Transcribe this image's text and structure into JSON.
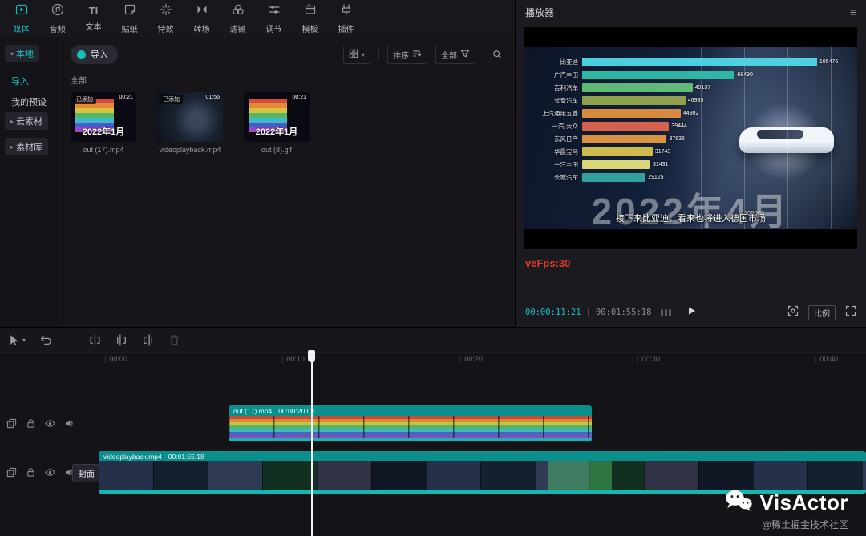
{
  "topbar": {
    "items": [
      {
        "label": "媒体"
      },
      {
        "label": "音频"
      },
      {
        "label": "文本"
      },
      {
        "label": "贴纸"
      },
      {
        "label": "特效"
      },
      {
        "label": "转场"
      },
      {
        "label": "滤镜"
      },
      {
        "label": "调节"
      },
      {
        "label": "模板"
      },
      {
        "label": "插件"
      }
    ]
  },
  "sidebar": {
    "local": "本地",
    "import": "导入",
    "presets": "我的预设",
    "cloud": "云素材",
    "library": "素材库"
  },
  "media": {
    "import_button": "导入",
    "sort": "排序",
    "filter": "全部",
    "group": "全部",
    "items": [
      {
        "name": "out (17).mp4",
        "duration": "00:21",
        "badge": "已添加",
        "overlay": "2022年1月"
      },
      {
        "name": "videoplayback.mp4",
        "duration": "01:56",
        "badge": "已添加"
      },
      {
        "name": "out (8).gif",
        "duration": "00:21",
        "overlay": "2022年1月"
      }
    ]
  },
  "player": {
    "title": "播放器",
    "fps": "veFps:30",
    "current": "00:00:11:21",
    "separator": "|",
    "total": "00:01:55:18",
    "ratio": "比例",
    "date_overlay": "2022年4月",
    "subtitle": "接下来比亚迪，看来也将进入德国市场",
    "axis_max": "100000",
    "chart": {
      "type": "bar",
      "bars": [
        {
          "label": "比亚迪",
          "value": "105476",
          "pct": 100,
          "color": "#4fd9e9"
        },
        {
          "label": "广汽丰田",
          "value": "68490",
          "pct": 65,
          "color": "#2fbfa9"
        },
        {
          "label": "吉利汽车",
          "value": "49137",
          "pct": 47,
          "color": "#66c27c"
        },
        {
          "label": "长安汽车",
          "value": "46935",
          "pct": 44,
          "color": "#95a84e"
        },
        {
          "label": "上汽通用五菱",
          "value": "44902",
          "pct": 42,
          "color": "#e2913f"
        },
        {
          "label": "一汽-大众",
          "value": "39444",
          "pct": 37,
          "color": "#e2654d"
        },
        {
          "label": "东风日产",
          "value": "37636",
          "pct": 36,
          "color": "#e59a3f"
        },
        {
          "label": "华晨宝马",
          "value": "31743",
          "pct": 30,
          "color": "#d9c44d"
        },
        {
          "label": "一汽丰田",
          "value": "31431",
          "pct": 29,
          "color": "#e6e07a"
        },
        {
          "label": "长城汽车",
          "value": "29125",
          "pct": 27,
          "color": "#35a8a2"
        }
      ]
    }
  },
  "timeline": {
    "ruler": [
      "00:00",
      "00:10",
      "00:20",
      "00:30",
      "00:40"
    ],
    "cover": "封面",
    "clips": [
      {
        "name": "out (17).mp4",
        "duration": "00:00:20:02"
      },
      {
        "name": "videoplayback.mp4",
        "duration": "00:01:55:18"
      }
    ]
  },
  "watermark": {
    "brand": "VisActor",
    "credit": "@稀土掘金技术社区"
  }
}
